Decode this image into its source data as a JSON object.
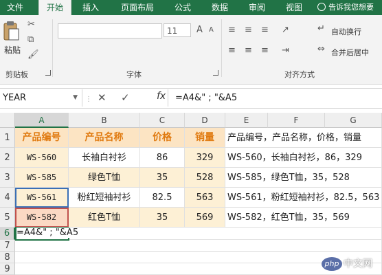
{
  "tabs": [
    {
      "label": "文件",
      "active": false
    },
    {
      "label": "开始",
      "active": true
    },
    {
      "label": "插入",
      "active": false
    },
    {
      "label": "页面布局",
      "active": false
    },
    {
      "label": "公式",
      "active": false
    },
    {
      "label": "数据",
      "active": false
    },
    {
      "label": "审阅",
      "active": false
    },
    {
      "label": "视图",
      "active": false
    }
  ],
  "tell_me": "告诉我您想要",
  "ribbon": {
    "paste_label": "粘贴",
    "clipboard_label": "剪贴板",
    "font_label": "字体",
    "font_size": "11",
    "align_label": "对齐方式",
    "wrap_text": "自动换行",
    "merge_center": "合并后居中"
  },
  "formula_bar": {
    "name_box": "YEAR",
    "formula": "=A4&\" ; \"&A5"
  },
  "columns": [
    "A",
    "B",
    "C",
    "D",
    "E",
    "F",
    "G"
  ],
  "rows": [
    "1",
    "2",
    "3",
    "4",
    "5",
    "6",
    "7",
    "8",
    "9"
  ],
  "table": {
    "headers": [
      "产品编号",
      "产品名称",
      "价格",
      "销量"
    ],
    "data": [
      [
        "WS-560",
        "长袖白衬衫",
        "86",
        "329"
      ],
      [
        "WS-585",
        "绿色T恤",
        "35",
        "528"
      ],
      [
        "WS-561",
        "粉红短袖衬衫",
        "82.5",
        "563"
      ],
      [
        "WS-582",
        "红色T恤",
        "35",
        "569"
      ]
    ]
  },
  "col_e": [
    "产品编号，产品名称，价格，销量",
    "WS-560，长袖白衬衫，86，329",
    "WS-585，绿色T恤，35，528",
    "WS-561，粉红短袖衬衫，82.5，563",
    "WS-582，红色T恤，35，569"
  ],
  "editing_text": "=A4&\" ; \"&A5",
  "watermark": {
    "badge": "php",
    "site": "中文网"
  },
  "colors": {
    "accent": "#217346",
    "header_fill": "#fce4c3",
    "header_text": "#e07a10",
    "data_fill": "#fdf0d5"
  }
}
